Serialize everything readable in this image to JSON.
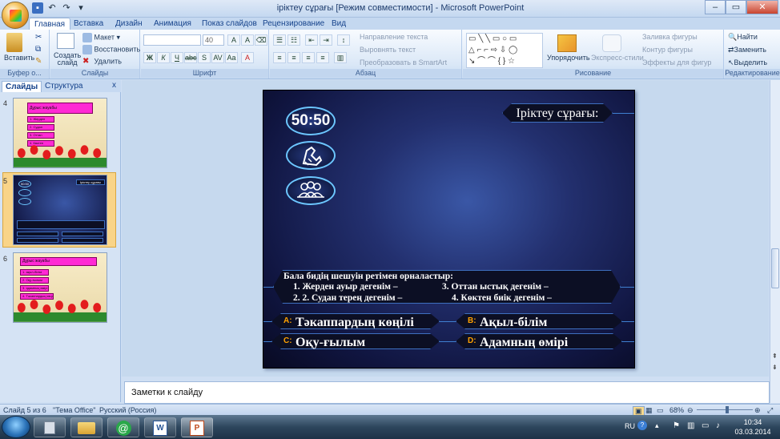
{
  "window": {
    "title": "іріктеу сұрағы [Режим совместимости] - Microsoft PowerPoint",
    "minimize": "–",
    "maximize": "▭",
    "close": "✕"
  },
  "ribbon_tabs": [
    "Главная",
    "Вставка",
    "Дизайн",
    "Анимация",
    "Показ слайдов",
    "Рецензирование",
    "Вид"
  ],
  "ribbon": {
    "clipboard": {
      "paste": "Вставить",
      "label": "Буфер о..."
    },
    "slides": {
      "new_slide": "Создать слайд",
      "layout": "Макет",
      "reset": "Восстановить",
      "delete": "Удалить",
      "label": "Слайды"
    },
    "font": {
      "font_name": "",
      "font_size": "40",
      "label": "Шрифт"
    },
    "paragraph": {
      "text_direction": "Направление текста",
      "align_text": "Выровнять текст",
      "smartart": "Преобразовать в SmartArt",
      "label": "Абзац"
    },
    "drawing": {
      "arrange": "Упорядочить",
      "quick_styles": "Экспресс-стили",
      "fill": "Заливка фигуры",
      "outline": "Контур фигуры",
      "effects": "Эффекты для фигур",
      "label": "Рисование"
    },
    "editing": {
      "find": "Найти",
      "replace": "Заменить",
      "select": "Выделить",
      "label": "Редактирование"
    }
  },
  "left_pane": {
    "tabs": [
      "Слайды",
      "Структура"
    ],
    "close": "x",
    "slides": [
      {
        "num": "4",
        "title": "Дұрыс жауабы",
        "items": [
          "1. Жерден",
          "2. Судан",
          "3. Оттан",
          "4. Көктен"
        ]
      },
      {
        "num": "5",
        "header": "Іріктеу сұрағы"
      },
      {
        "num": "6",
        "title": "Дұрыс жауабы",
        "items": [
          "1. ақыл-білім",
          "2. Оқу-ғылым",
          "3. адамның өмірі",
          "4. Тәкаппардың көңілі"
        ]
      }
    ]
  },
  "slide": {
    "lifeline_5050": "50:50",
    "title": "Іріктеу сұрағы:",
    "question_intro": "Бала бидің шешуін ретімен орналастыр:",
    "q1": "1.    Жерден ауыр дегенім –",
    "q3": "3. Оттан ыстық дегенім –",
    "q2": "2.    2. Судан терең дегенім –",
    "q4": "4. Көктен биік дегенім –",
    "answers": [
      {
        "letter": "A:",
        "text": "Тәкаппардың көңілі"
      },
      {
        "letter": "B:",
        "text": "Ақыл-білім"
      },
      {
        "letter": "C:",
        "text": "Оқу-ғылым"
      },
      {
        "letter": "D:",
        "text": "Адамның өмірі"
      }
    ],
    "colors": {
      "bg": "#23306f",
      "border": "#3e6fbf",
      "letter": "#ffa200"
    }
  },
  "notes": {
    "placeholder": "Заметки к слайду"
  },
  "status": {
    "slide_info": "Слайд 5 из 6",
    "theme": "\"Тема Office\"",
    "language": "Русский (Россия)",
    "zoom": "68%"
  },
  "taskbar": {
    "lang": "RU",
    "time": "10:34",
    "date": "03.03.2014"
  }
}
